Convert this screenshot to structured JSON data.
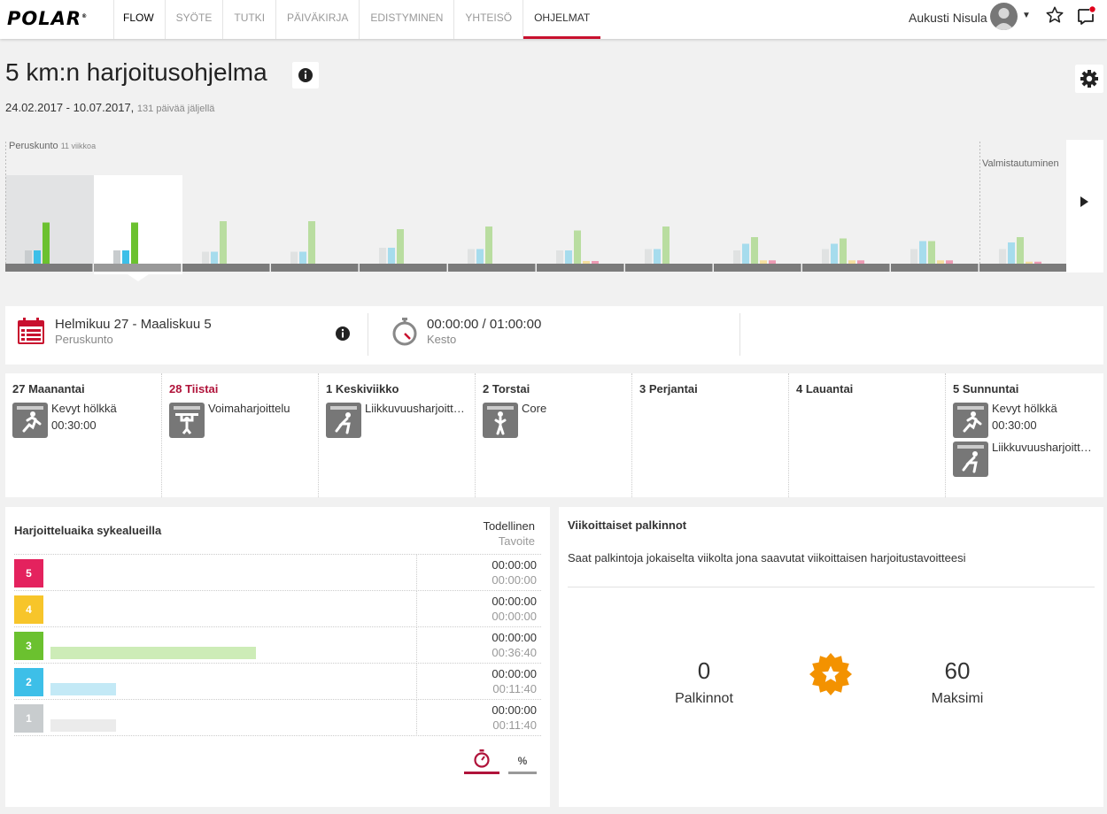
{
  "nav": {
    "logo": "POLAR",
    "logo_mark": "®",
    "links": [
      "FLOW",
      "SYÖTE",
      "TUTKI",
      "PÄIVÄKIRJA",
      "EDISTYMINEN",
      "YHTEISÖ",
      "OHJELMAT"
    ],
    "active": "OHJELMAT",
    "user_name": "Aukusti Nisula",
    "icons": [
      "user-avatar",
      "chevron-down-icon",
      "star-icon",
      "messages-icon"
    ]
  },
  "program": {
    "title": "5 km:n harjoitusohjelma",
    "date_range": "24.02.2017 - 10.07.2017,",
    "days_left": "131 päivää jäljellä"
  },
  "phases": {
    "base": "Peruskunto",
    "base_length": "11 viikkoa",
    "prep": "Valmistautuminen"
  },
  "weekly_chart": {
    "selected_week": 2,
    "series_colors": [
      "#c8ccce",
      "#3dbfe8",
      "#6bc12f",
      "#f7c52a",
      "#e4225e"
    ],
    "weeks": [
      {
        "zone1": 20,
        "zone2": 20,
        "zone3": 62,
        "zone4": 0,
        "zone5": 0
      },
      {
        "zone1": 20,
        "zone2": 20,
        "zone3": 62,
        "zone4": 0,
        "zone5": 0
      },
      {
        "zone1": 18,
        "zone2": 18,
        "zone3": 64,
        "zone4": 0,
        "zone5": 0
      },
      {
        "zone1": 18,
        "zone2": 18,
        "zone3": 64,
        "zone4": 0,
        "zone5": 0
      },
      {
        "zone1": 24,
        "zone2": 24,
        "zone3": 52,
        "zone4": 0,
        "zone5": 0
      },
      {
        "zone1": 22,
        "zone2": 22,
        "zone3": 56,
        "zone4": 0,
        "zone5": 0
      },
      {
        "zone1": 20,
        "zone2": 20,
        "zone3": 50,
        "zone4": 4,
        "zone5": 4
      },
      {
        "zone1": 22,
        "zone2": 22,
        "zone3": 56,
        "zone4": 0,
        "zone5": 0
      },
      {
        "zone1": 20,
        "zone2": 30,
        "zone3": 40,
        "zone4": 5,
        "zone5": 5
      },
      {
        "zone1": 22,
        "zone2": 30,
        "zone3": 38,
        "zone4": 5,
        "zone5": 5
      },
      {
        "zone1": 22,
        "zone2": 34,
        "zone3": 34,
        "zone4": 5,
        "zone5": 5
      },
      {
        "zone1": 22,
        "zone2": 32,
        "zone3": 40,
        "zone4": 3,
        "zone5": 3
      }
    ]
  },
  "period": {
    "range": "Helmikuu 27 - Maaliskuu 5",
    "phase": "Peruskunto",
    "duration": "00:00:00 / 01:00:00",
    "duration_label": "Kesto"
  },
  "days": [
    {
      "head": "27 Maanantai",
      "today": false,
      "activities": [
        {
          "name": "Kevyt hölkkä",
          "time": "00:30:00",
          "icon": "running-icon"
        }
      ]
    },
    {
      "head": "28 Tiistai",
      "today": true,
      "activities": [
        {
          "name": "Voimaharjoittelu",
          "time": "",
          "icon": "strength-training-icon"
        }
      ]
    },
    {
      "head": "1   Keskiviikko",
      "today": false,
      "activities": [
        {
          "name": "Liikkuvuusharjoittelu",
          "time": "",
          "icon": "mobility-icon"
        }
      ]
    },
    {
      "head": "2   Torstai",
      "today": false,
      "activities": [
        {
          "name": "Core",
          "time": "",
          "icon": "core-training-icon"
        }
      ]
    },
    {
      "head": "3   Perjantai",
      "today": false,
      "activities": []
    },
    {
      "head": "4   Lauantai",
      "today": false,
      "activities": []
    },
    {
      "head": "5   Sunnuntai",
      "today": false,
      "activities": [
        {
          "name": "Kevyt hölkkä",
          "time": "00:30:00",
          "icon": "running-icon"
        },
        {
          "name": "Liikkuvuusharjoittelu",
          "time": "",
          "icon": "mobility-icon"
        }
      ]
    }
  ],
  "zones": {
    "title": "Harjoitteluaika sykealueilla",
    "actual_label": "Todellinen",
    "target_label": "Tavoite",
    "max_minutes": 60,
    "rows": [
      {
        "zone": "5",
        "color": "#e4225e",
        "actual": "00:00:00",
        "target": "00:00:00",
        "target_minutes": 0,
        "bar_color": "#f7c6d5"
      },
      {
        "zone": "4",
        "color": "#f7c52a",
        "actual": "00:00:00",
        "target": "00:00:00",
        "target_minutes": 0,
        "bar_color": "#fbeab0"
      },
      {
        "zone": "3",
        "color": "#6bc12f",
        "actual": "00:00:00",
        "target": "00:36:40",
        "target_minutes": 36.67,
        "bar_color": "#cdecb7"
      },
      {
        "zone": "2",
        "color": "#3dbfe8",
        "actual": "00:00:00",
        "target": "00:11:40",
        "target_minutes": 11.67,
        "bar_color": "#c3e9f6"
      },
      {
        "zone": "1",
        "color": "#c8ccce",
        "actual": "00:00:00",
        "target": "00:11:40",
        "target_minutes": 11.67,
        "bar_color": "#ebebeb"
      }
    ],
    "tab_percent": "%"
  },
  "rewards": {
    "title": "Viikoittaiset palkinnot",
    "description": "Saat palkintoja jokaiselta viikolta jona saavutat viikoittaisen harjoitustavoitteesi",
    "count": "0",
    "count_label": "Palkinnot",
    "max": "60",
    "max_label": "Maksimi"
  }
}
